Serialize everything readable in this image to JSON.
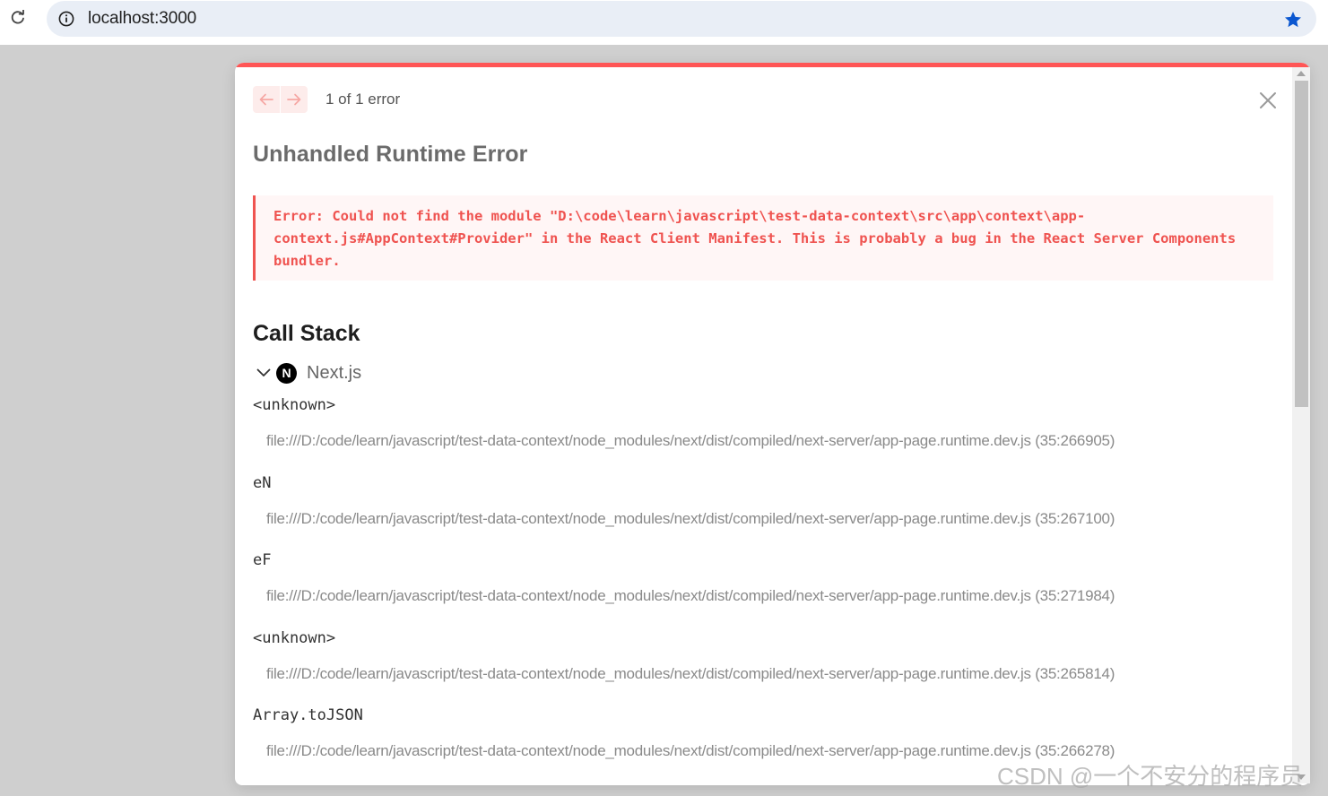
{
  "browser": {
    "url": "localhost:3000",
    "reload_icon": "reload-icon",
    "info_icon": "info-circle-icon",
    "bookmark_icon": "bookmark-star-icon",
    "bookmark_color": "#0b57d0"
  },
  "overlay": {
    "accent_color": "#ff5555",
    "error_count": "1 of 1 error",
    "prev_icon": "arrow-left-icon",
    "next_icon": "arrow-right-icon",
    "close_icon": "close-icon",
    "title": "Unhandled Runtime Error",
    "error_message": "Error: Could not find the module \"D:\\code\\learn\\javascript\\test-data-context\\src\\app\\context\\app-context.js#AppContext#Provider\" in the React Client Manifest. This is probably a bug in the React Server Components bundler.",
    "error_color": "#ef5350",
    "call_stack_title": "Call Stack",
    "framework": {
      "icon": "chevron-down-icon",
      "logo_letter": "N",
      "label": "Next.js"
    },
    "frames": [
      {
        "name": "<unknown>",
        "path": "file:///D:/code/learn/javascript/test-data-context/node_modules/next/dist/compiled/next-server/app-page.runtime.dev.js (35:266905)"
      },
      {
        "name": "eN",
        "path": "file:///D:/code/learn/javascript/test-data-context/node_modules/next/dist/compiled/next-server/app-page.runtime.dev.js (35:267100)"
      },
      {
        "name": "eF",
        "path": "file:///D:/code/learn/javascript/test-data-context/node_modules/next/dist/compiled/next-server/app-page.runtime.dev.js (35:271984)"
      },
      {
        "name": "<unknown>",
        "path": "file:///D:/code/learn/javascript/test-data-context/node_modules/next/dist/compiled/next-server/app-page.runtime.dev.js (35:265814)"
      },
      {
        "name": "Array.toJSON",
        "path": "file:///D:/code/learn/javascript/test-data-context/node_modules/next/dist/compiled/next-server/app-page.runtime.dev.js (35:266278)"
      }
    ]
  },
  "watermark": "CSDN @一个不安分的程序员"
}
